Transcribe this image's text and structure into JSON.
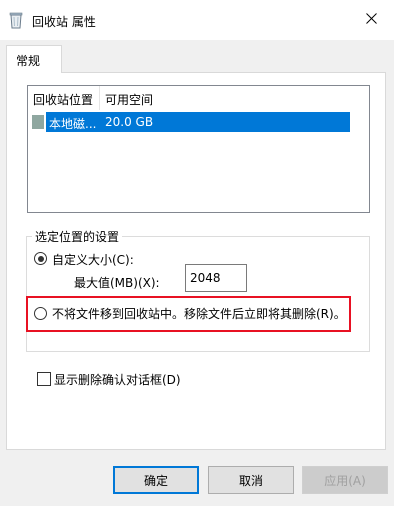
{
  "window": {
    "title": "回收站 属性",
    "icon": "recycle-bin-icon",
    "close_icon": "close-icon"
  },
  "tabs": [
    {
      "label": "常规",
      "selected": true
    }
  ],
  "location_list": {
    "columns": [
      "回收站位置",
      "可用空间"
    ],
    "rows": [
      {
        "location": "本地磁...",
        "free_space": "20.0 GB",
        "selected": true
      }
    ]
  },
  "settings_group": {
    "legend": "选定位置的设置",
    "custom_size_label": "自定义大小(C):",
    "custom_size_selected": true,
    "max_size_label": "最大值(MB)(X):",
    "max_size_value": "2048",
    "no_move_label": "不将文件移到回收站中。移除文件后立即将其删除(R)。",
    "no_move_selected": false
  },
  "confirm_checkbox": {
    "label": "显示删除确认对话框(D)",
    "checked": false
  },
  "buttons": {
    "ok": "确定",
    "cancel": "取消",
    "apply": "应用(A)"
  },
  "colors": {
    "selection": "#0078d7",
    "highlight_border": "#e81123"
  }
}
